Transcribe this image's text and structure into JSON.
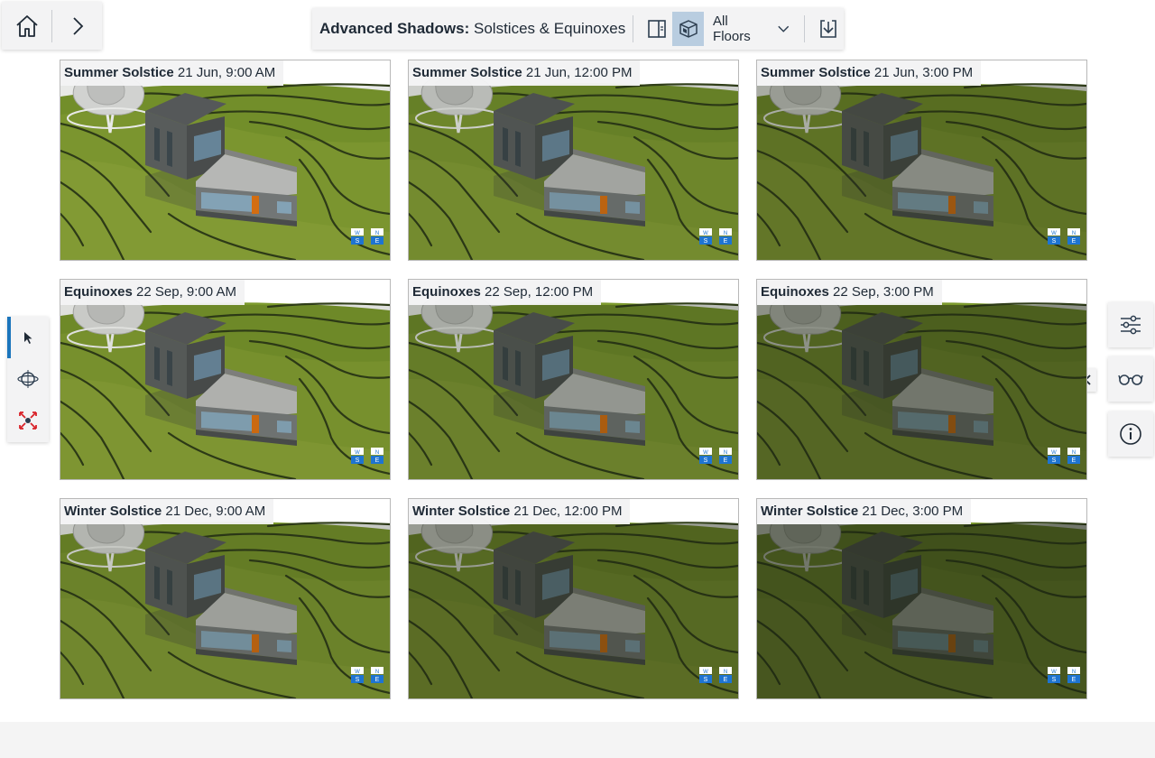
{
  "toolbar": {
    "title_bold": "Advanced Shadows:",
    "title_rest": "Solstices & Equinoxes",
    "floors_label": "All Floors"
  },
  "icons": {
    "home": "home-icon",
    "forward": "chevron-right-icon",
    "panel": "panel-icon",
    "model": "model-icon",
    "dropdown": "chevron-down-icon",
    "download": "download-icon",
    "select": "cursor-icon",
    "orbit": "orbit-icon",
    "zoom_extents": "zoom-extents-icon",
    "settings": "sliders-icon",
    "view": "glasses-icon",
    "info": "info-icon",
    "collapse": "double-chevron-left-icon"
  },
  "colors": {
    "accent": "#1b75bc",
    "grass": "#7c9a2d",
    "grass_light": "#95ae3c",
    "contour": "#2f3d18",
    "roof": "#5c5e61",
    "door": "#e87511",
    "compass": "#1e74d1"
  },
  "compass": {
    "w": "W",
    "s": "S",
    "n": "N",
    "e": "E"
  },
  "tiles": [
    {
      "season": "Summer Solstice",
      "time": "21 Jun, 9:00 AM",
      "shadow": 0.1
    },
    {
      "season": "Summer Solstice",
      "time": "21 Jun, 12:00 PM",
      "shadow": 0.22
    },
    {
      "season": "Summer Solstice",
      "time": "21 Jun, 3:00 PM",
      "shadow": 0.38
    },
    {
      "season": "Equinoxes",
      "time": "22 Sep, 9:00 AM",
      "shadow": 0.14
    },
    {
      "season": "Equinoxes",
      "time": "22 Sep, 12:00 PM",
      "shadow": 0.3
    },
    {
      "season": "Equinoxes",
      "time": "22 Sep, 3:00 PM",
      "shadow": 0.5
    },
    {
      "season": "Winter Solstice",
      "time": "21 Dec, 9:00 AM",
      "shadow": 0.25
    },
    {
      "season": "Winter Solstice",
      "time": "21 Dec, 12:00 PM",
      "shadow": 0.45
    },
    {
      "season": "Winter Solstice",
      "time": "21 Dec, 3:00 PM",
      "shadow": 0.62
    }
  ]
}
